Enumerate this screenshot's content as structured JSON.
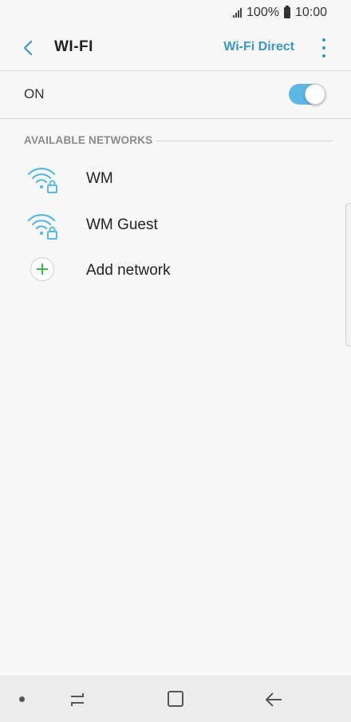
{
  "status_bar": {
    "battery": "100%",
    "time": "10:00"
  },
  "app_bar": {
    "title": "WI-FI",
    "action_label": "Wi-Fi Direct"
  },
  "master_switch": {
    "label": "ON",
    "state": "on"
  },
  "section": {
    "header": "AVAILABLE NETWORKS"
  },
  "networks": [
    {
      "name": "WM",
      "icon": "wifi-locked-icon"
    },
    {
      "name": "WM Guest",
      "icon": "wifi-locked-icon"
    }
  ],
  "add_network": {
    "label": "Add network",
    "icon": "plus-icon"
  },
  "colors": {
    "accent": "#3d97bd",
    "toggle": "#5fb7e4",
    "plus": "#3fb149",
    "wifi_icon": "#5ab9de"
  }
}
